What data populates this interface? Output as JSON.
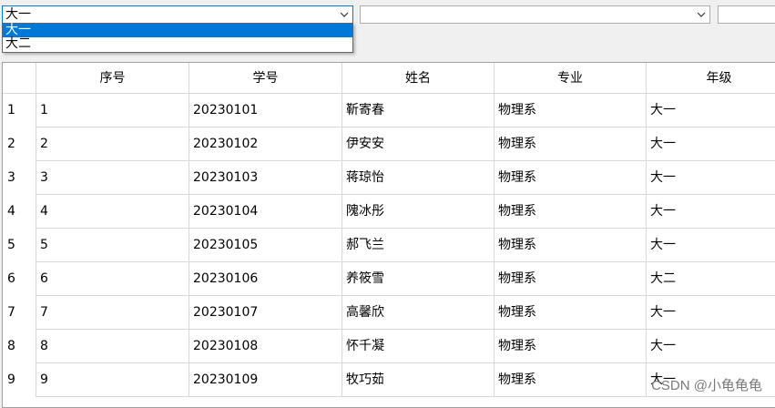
{
  "filters": [
    {
      "value": "大一",
      "dropdown_open": true,
      "options": [
        "大一",
        "大二"
      ],
      "selected_index": 0
    },
    {
      "value": ""
    },
    {
      "value": ""
    }
  ],
  "table": {
    "columns": [
      "序号",
      "学号",
      "姓名",
      "专业",
      "年级"
    ],
    "rows": [
      {
        "index": "1",
        "cells": [
          "1",
          "20230101",
          "靳寄春",
          "物理系",
          "大一"
        ]
      },
      {
        "index": "2",
        "cells": [
          "2",
          "20230102",
          "伊安安",
          "物理系",
          "大一"
        ]
      },
      {
        "index": "3",
        "cells": [
          "3",
          "20230103",
          "蒋琼怡",
          "物理系",
          "大一"
        ]
      },
      {
        "index": "4",
        "cells": [
          "4",
          "20230104",
          "隗冰彤",
          "物理系",
          "大一"
        ]
      },
      {
        "index": "5",
        "cells": [
          "5",
          "20230105",
          "郝飞兰",
          "物理系",
          "大一"
        ]
      },
      {
        "index": "6",
        "cells": [
          "6",
          "20230106",
          "养筱雪",
          "物理系",
          "大二"
        ]
      },
      {
        "index": "7",
        "cells": [
          "7",
          "20230107",
          "高馨欣",
          "物理系",
          "大一"
        ]
      },
      {
        "index": "8",
        "cells": [
          "8",
          "20230108",
          "怀千凝",
          "物理系",
          "大一"
        ]
      },
      {
        "index": "9",
        "cells": [
          "9",
          "20230109",
          "牧巧茹",
          "物理系",
          "大一"
        ]
      }
    ]
  },
  "watermark": "CSDN @小龟龟龟",
  "colors": {
    "selection": "#0078d7",
    "gridline": "#d8d8d8",
    "background": "#f0f0f0"
  },
  "icons": {
    "combo_arrow": "chevron-down-icon"
  }
}
